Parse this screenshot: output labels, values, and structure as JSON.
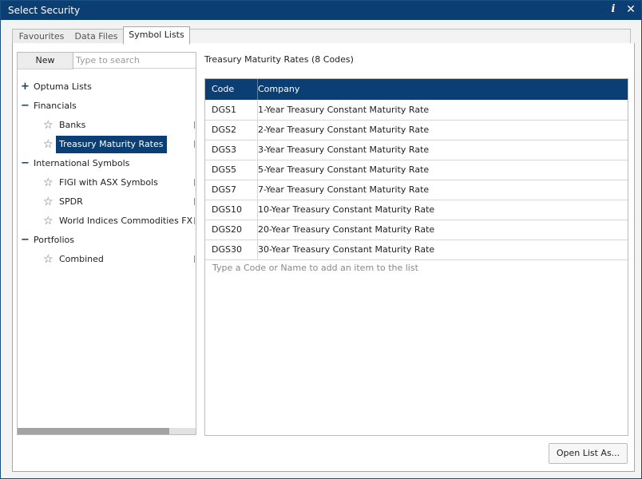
{
  "window": {
    "title": "Select Security",
    "info_glyph": "i",
    "close_glyph": "✕"
  },
  "tabs": [
    {
      "label": "Favourites",
      "active": false
    },
    {
      "label": "Data Files",
      "active": false
    },
    {
      "label": "Symbol Lists",
      "active": true
    }
  ],
  "left": {
    "new_label": "New",
    "search_placeholder": "Type to search",
    "tree": [
      {
        "label": "Optuma Lists",
        "type": "group",
        "expander": "+"
      },
      {
        "label": "Financials",
        "type": "group",
        "expander": "−"
      },
      {
        "label": "Banks",
        "type": "list",
        "icon": "star-icon"
      },
      {
        "label": "Treasury Maturity Rates",
        "type": "list",
        "icon": "star-icon",
        "selected": true
      },
      {
        "label": "International Symbols",
        "type": "group",
        "expander": "−"
      },
      {
        "label": "FIGI with ASX Symbols",
        "type": "list",
        "icon": "star-icon"
      },
      {
        "label": "SPDR",
        "type": "list",
        "icon": "star-icon"
      },
      {
        "label": "World Indices Commodities FX",
        "type": "list",
        "icon": "star-icon"
      },
      {
        "label": "Portfolios",
        "type": "group",
        "expander": "−"
      },
      {
        "label": "Combined",
        "type": "list",
        "icon": "star-icon"
      }
    ]
  },
  "main": {
    "list_title": "Treasury Maturity Rates (8 Codes)",
    "columns": [
      "Code",
      "Company"
    ],
    "rows": [
      {
        "code": "DGS1",
        "company": "1-Year Treasury Constant Maturity Rate"
      },
      {
        "code": "DGS2",
        "company": "2-Year Treasury Constant Maturity Rate"
      },
      {
        "code": "DGS3",
        "company": "3-Year Treasury Constant Maturity Rate"
      },
      {
        "code": "DGS5",
        "company": "5-Year Treasury Constant Maturity Rate"
      },
      {
        "code": "DGS7",
        "company": "7-Year Treasury Constant Maturity Rate"
      },
      {
        "code": "DGS10",
        "company": "10-Year Treasury Constant Maturity Rate"
      },
      {
        "code": "DGS20",
        "company": "20-Year Treasury Constant Maturity Rate"
      },
      {
        "code": "DGS30",
        "company": "30-Year Treasury Constant Maturity Rate"
      }
    ],
    "add_hint": "Type a Code or Name to add an item to the list"
  },
  "footer": {
    "open_list_label": "Open List As..."
  },
  "colors": {
    "accent": "#0b3f73",
    "selected_bg": "#0b3f73",
    "header_text": "#ffffff"
  }
}
